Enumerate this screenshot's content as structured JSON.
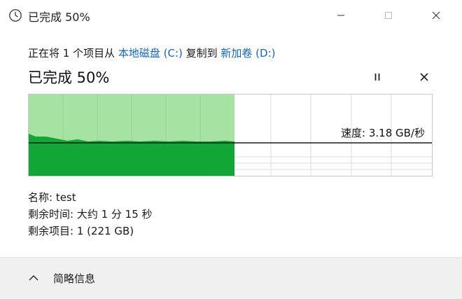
{
  "window": {
    "title": "已完成 50%"
  },
  "icons": {
    "app": "clock-icon",
    "minimize": "minimize-icon",
    "maximize": "maximize-icon",
    "close": "close-icon",
    "pause": "pause-icon",
    "cancel": "cancel-icon",
    "toggle": "chevron-up-icon"
  },
  "status": {
    "prefix": "正在将 1 个项目从 ",
    "source": "本地磁盘 (C:)",
    "middle": " 复制到 ",
    "destination": "新加卷 (D:)"
  },
  "progress": {
    "title": "已完成 50%",
    "fraction": 0.5
  },
  "graph": {
    "speed_label": "速度: 3.18 GB/秒",
    "colors": {
      "light": "#a6e3a0",
      "dark": "#11a636",
      "line": "#1a1a1a",
      "grid": "#dcdcdc"
    }
  },
  "details": {
    "name": "名称: test",
    "time_remaining": "剩余时间: 大约 1 分 15 秒",
    "items_remaining": "剩余项目: 1 (221 GB)"
  },
  "footer": {
    "toggle_label": "简略信息"
  }
}
